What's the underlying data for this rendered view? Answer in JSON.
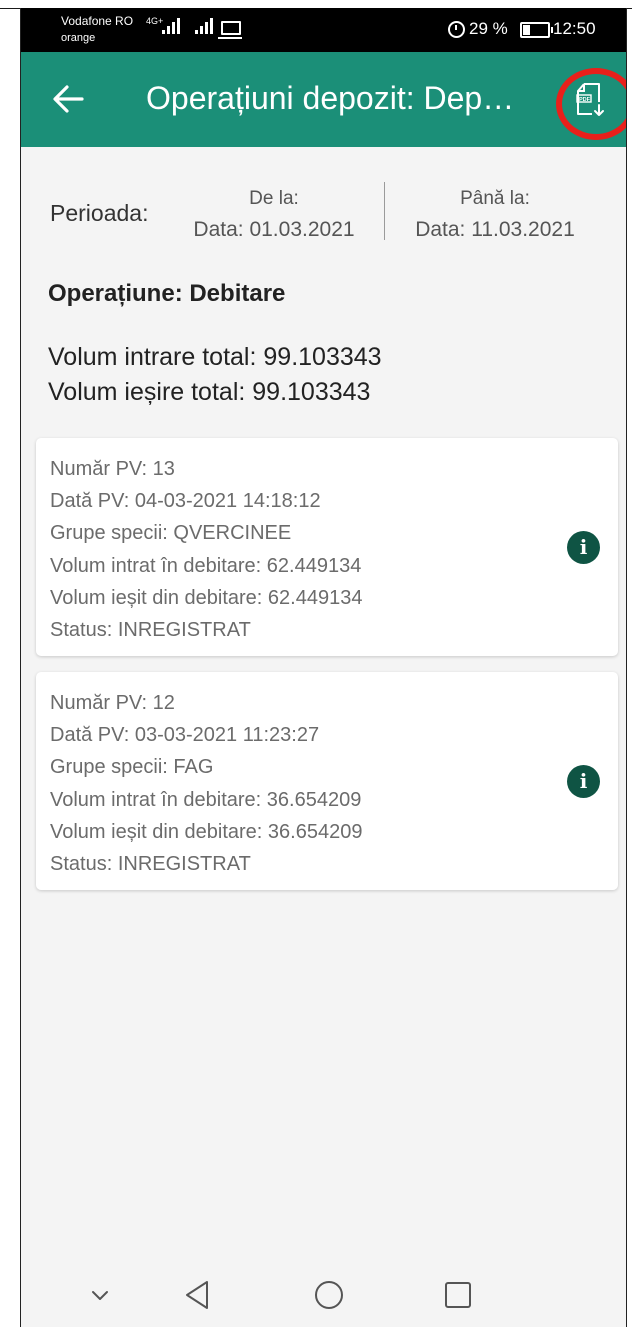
{
  "status_bar": {
    "carrier_primary": "Vodafone RO",
    "network_badge": "4G+",
    "carrier_secondary": "orange",
    "battery": "29 %",
    "time": "12:50",
    "icons": [
      "signal-icon",
      "signal-icon",
      "laptop-icon",
      "alarm-icon",
      "battery-icon"
    ]
  },
  "toolbar": {
    "title": "Operațiuni depozit: Dep…",
    "back_icon": "arrow-left-icon",
    "pdf_icon": "pdf-download-icon",
    "bg_color": "#1b8f78",
    "highlight_color": "#e8201b"
  },
  "period": {
    "label": "Perioada:",
    "from_title": "De la:",
    "from_value": "Data: 01.03.2021",
    "to_title": "Până la:",
    "to_value": "Data: 11.03.2021"
  },
  "operation": {
    "label": "Operațiune: Debitare",
    "total_in": "Volum intrare total: 99.103343",
    "total_out": "Volum ieșire total: 99.103343"
  },
  "records": [
    {
      "pv_number": "Număr PV: 13",
      "pv_date": "Dată PV: 04-03-2021 14:18:12",
      "species": "Grupe specii: QVERCINEE",
      "volume_in": "Volum intrat în debitare: 62.449134",
      "volume_out": "Volum ieșit din debitare: 62.449134",
      "status": "Status: INREGISTRAT",
      "info_icon": "info-icon"
    },
    {
      "pv_number": "Număr PV: 12",
      "pv_date": "Dată PV: 03-03-2021 11:23:27",
      "species": "Grupe specii: FAG",
      "volume_in": "Volum intrat în debitare: 36.654209",
      "volume_out": "Volum ieșit din debitare: 36.654209",
      "status": "Status: INREGISTRAT",
      "info_icon": "info-icon"
    }
  ],
  "nav_bar": {
    "icons": [
      "chevron-down-icon",
      "triangle-back-icon",
      "circle-home-icon",
      "square-recents-icon"
    ]
  },
  "info_glyph": "i"
}
